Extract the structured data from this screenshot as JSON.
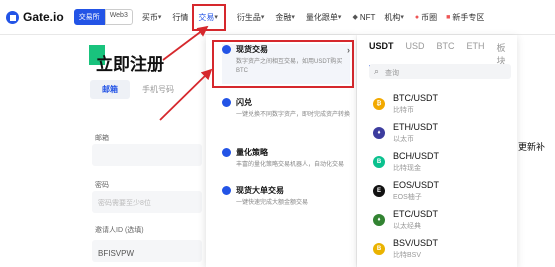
{
  "nav": {
    "logo": "Gate.io",
    "exchange_pill": "交易所",
    "web3_pill": "Web3",
    "items": [
      "买币",
      "行情",
      "交易",
      "衍生品",
      "金融",
      "量化跟单",
      "NFT",
      "机构",
      "币圈",
      "新手专区"
    ]
  },
  "form": {
    "title": "立即注册",
    "tab_email": "邮箱",
    "tab_phone": "手机号码",
    "email_label": "邮箱",
    "password_label": "密码",
    "password_placeholder": "密码需要至少8位",
    "invite_label": "邀请人ID (选填)",
    "invite_value": "BFISVPW"
  },
  "trade_menu": [
    {
      "title": "现货交易",
      "desc": "数字资产之间相互交易，如用USDT购买BTC"
    },
    {
      "title": "闪兑",
      "desc": "一键兑换不同数字资产，即时完成资产转换"
    },
    {
      "title": "量化策略",
      "desc": "丰富的量化策略交易机器人，自动化交易"
    },
    {
      "title": "现货大单交易",
      "desc": "一键快速完成大额金额交易"
    }
  ],
  "market": {
    "tabs": [
      "USDT",
      "USD",
      "BTC",
      "ETH",
      "板块"
    ],
    "search_placeholder": "查询",
    "pairs": [
      {
        "pair": "BTC/USDT",
        "name": "比特币",
        "color": "#f2a900",
        "sym": "₿"
      },
      {
        "pair": "ETH/USDT",
        "name": "以太币",
        "color": "#3c3c9e",
        "sym": "♦"
      },
      {
        "pair": "BCH/USDT",
        "name": "比特现金",
        "color": "#0ac18e",
        "sym": "B"
      },
      {
        "pair": "EOS/USDT",
        "name": "EOS柚子",
        "color": "#111111",
        "sym": "E"
      },
      {
        "pair": "ETC/USDT",
        "name": "以太经典",
        "color": "#328332",
        "sym": "♦"
      },
      {
        "pair": "BSV/USDT",
        "name": "比特BSV",
        "color": "#eab300",
        "sym": "B"
      }
    ]
  },
  "edge_text": "更新补"
}
